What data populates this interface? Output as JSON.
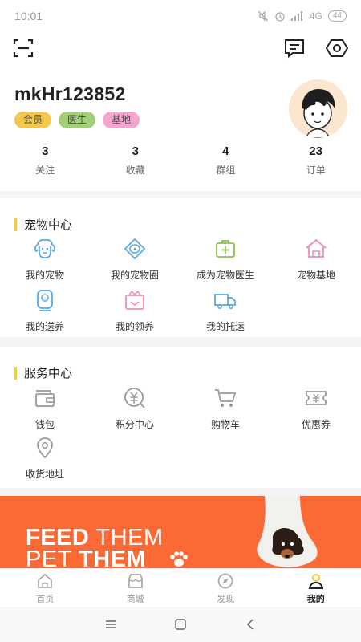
{
  "status": {
    "time": "10:01",
    "network": "4G",
    "battery": "44"
  },
  "icons": {
    "scan": "scan-icon",
    "message": "message-icon",
    "settings": "settings-icon"
  },
  "profile": {
    "username": "mkHr123852",
    "badges": [
      {
        "label": "会员",
        "color": "#f2c94c"
      },
      {
        "label": "医生",
        "color": "#a3cf7a"
      },
      {
        "label": "基地",
        "color": "#f5a6cf"
      }
    ],
    "stats": [
      {
        "value": "3",
        "label": "关注"
      },
      {
        "value": "3",
        "label": "收藏"
      },
      {
        "value": "4",
        "label": "群组"
      },
      {
        "value": "23",
        "label": "订单"
      }
    ]
  },
  "pet_center": {
    "title": "宠物中心",
    "items": [
      {
        "label": "我的宠物",
        "icon": "dog-face-icon"
      },
      {
        "label": "我的宠物圈",
        "icon": "pet-circle-icon"
      },
      {
        "label": "成为宠物医生",
        "icon": "medical-kit-icon"
      },
      {
        "label": "宠物基地",
        "icon": "pet-house-icon"
      },
      {
        "label": "我的送养",
        "icon": "give-away-icon"
      },
      {
        "label": "我的领养",
        "icon": "adopt-icon"
      },
      {
        "label": "我的托运",
        "icon": "truck-icon"
      }
    ]
  },
  "service_center": {
    "title": "服务中心",
    "items": [
      {
        "label": "钱包",
        "icon": "wallet-icon"
      },
      {
        "label": "积分中心",
        "icon": "points-icon"
      },
      {
        "label": "购物车",
        "icon": "cart-icon"
      },
      {
        "label": "优惠券",
        "icon": "coupon-icon"
      },
      {
        "label": "收货地址",
        "icon": "location-icon"
      }
    ]
  },
  "banner": {
    "line1_a": "FEED",
    "line1_b": "THEM",
    "line2_a": "PET",
    "line2_b": "THEM",
    "bg": "#fb6a34"
  },
  "tabs": [
    {
      "label": "首页",
      "icon": "home-icon"
    },
    {
      "label": "商城",
      "icon": "shop-icon"
    },
    {
      "label": "发现",
      "icon": "compass-icon"
    },
    {
      "label": "我的",
      "icon": "user-icon",
      "active": true
    }
  ],
  "accent": "#f2c94c"
}
